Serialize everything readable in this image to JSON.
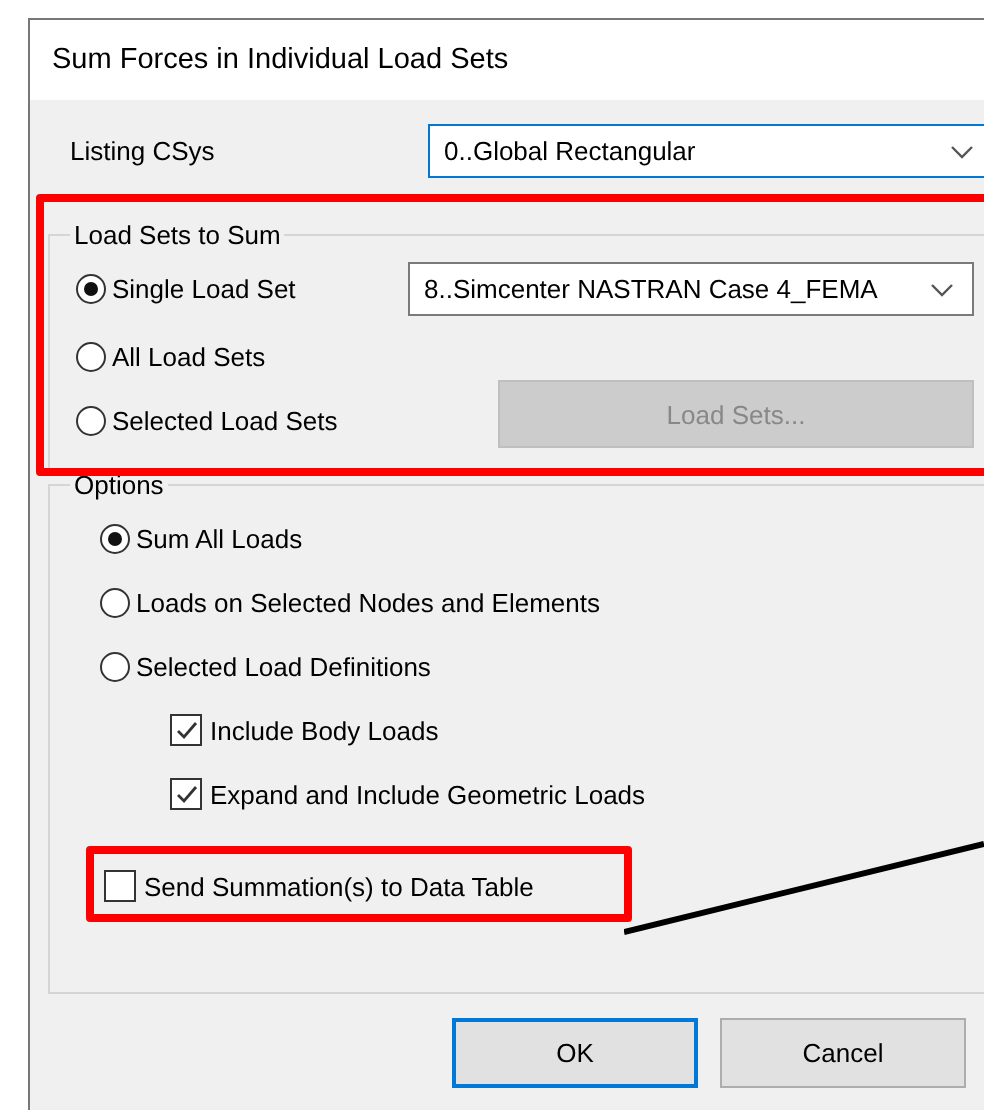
{
  "window": {
    "title": "Sum Forces in Individual Load Sets"
  },
  "listing_csys": {
    "label": "Listing CSys",
    "value": "0..Global Rectangular"
  },
  "load_sets_group": {
    "legend": "Load Sets to Sum",
    "highlighted": true,
    "options": [
      {
        "label": "Single Load Set",
        "selected": true
      },
      {
        "label": "All Load Sets",
        "selected": false
      },
      {
        "label": "Selected Load Sets",
        "selected": false
      }
    ],
    "load_set_value": "8..Simcenter NASTRAN Case 4_FEMA",
    "load_sets_button": {
      "label": "Load Sets...",
      "disabled": true
    }
  },
  "options_group": {
    "legend": "Options",
    "radios": [
      {
        "label": "Sum All Loads",
        "selected": true
      },
      {
        "label": "Loads on Selected Nodes and Elements",
        "selected": false
      },
      {
        "label": "Selected Load Definitions",
        "selected": false
      }
    ],
    "checkboxes": [
      {
        "label": "Include Body Loads",
        "checked": true
      },
      {
        "label": "Expand and Include Geometric Loads",
        "checked": true
      }
    ],
    "send_summation": {
      "label": "Send Summation(s) to Data Table",
      "checked": false,
      "highlighted": true
    }
  },
  "buttons": [
    {
      "label": "OK",
      "default": true
    },
    {
      "label": "Cancel",
      "default": false
    }
  ]
}
